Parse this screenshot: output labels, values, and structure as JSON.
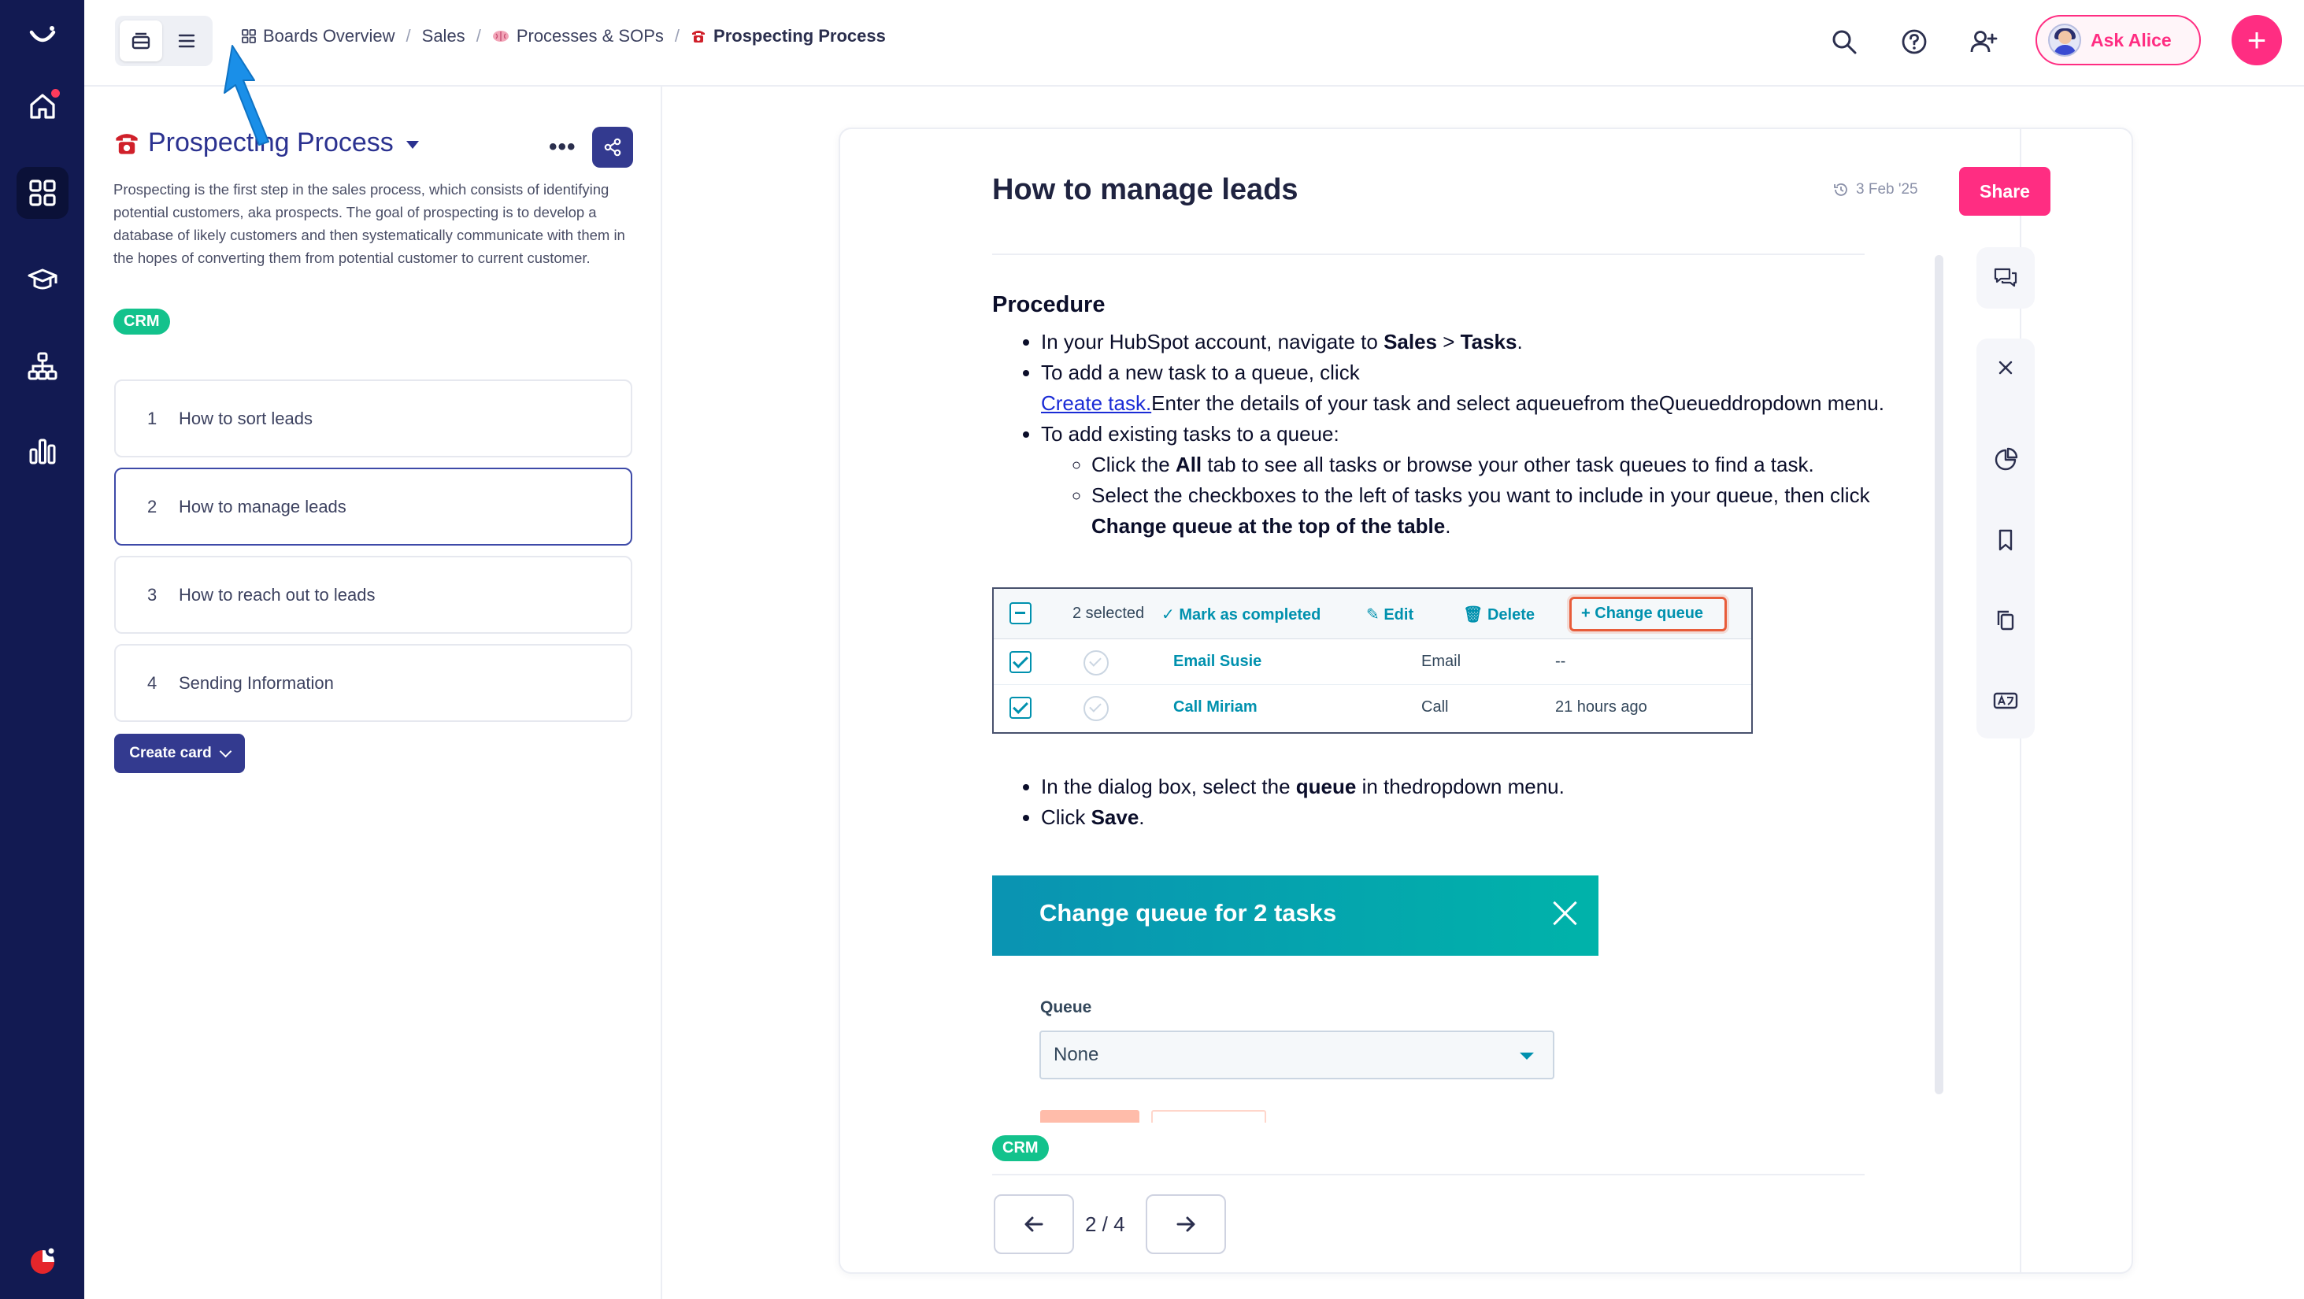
{
  "colors": {
    "rail": "#121a52",
    "brand_pink": "#ff2d82",
    "indigo": "#333a8f",
    "tag_green": "#13c28c",
    "pointer_blue": "#1a8fe8"
  },
  "rail": {
    "items": [
      {
        "icon": "home-icon",
        "active": false
      },
      {
        "icon": "boards-grid-icon",
        "active": true
      },
      {
        "icon": "graduation-cap-icon",
        "active": false
      },
      {
        "icon": "org-chart-icon",
        "active": false
      },
      {
        "icon": "bar-chart-icon",
        "active": false
      }
    ]
  },
  "topbar": {
    "breadcrumbs": [
      {
        "icon": "grid-icon",
        "label": "Boards Overview"
      },
      {
        "icon": "",
        "label": "Sales"
      },
      {
        "icon": "brain-emoji",
        "label": "Processes & SOPs"
      },
      {
        "icon": "telephone-emoji",
        "label": "Prospecting Process"
      }
    ],
    "ask_label": "Ask Alice"
  },
  "board": {
    "title": "Prospecting Process",
    "description": "Prospecting is the first step in the sales process, which consists of identifying potential customers, aka prospects. The goal of prospecting is to develop a database of likely customers and then systematically communicate with them in the hopes of converting them from potential customer to current customer.",
    "tag": "CRM",
    "cards": [
      {
        "num": "1",
        "label": "How to sort leads",
        "active": false
      },
      {
        "num": "2",
        "label": "How to manage leads",
        "active": true
      },
      {
        "num": "3",
        "label": "How to reach out to leads",
        "active": false
      },
      {
        "num": "4",
        "label": "Sending Information",
        "active": false
      }
    ],
    "create_card_label": "Create card"
  },
  "doc": {
    "title": "How to manage leads",
    "date": "3 Feb '25",
    "procedure_heading": "Procedure",
    "step1_pre": "In your HubSpot account, navigate to ",
    "step1_sales": "Sales",
    "step1_gt": " > ",
    "step1_tasks": "Tasks",
    "step1_end": ".",
    "step2_pre": "To add a new task to a queue, click",
    "step2_link": "Create task.",
    "step2_post": "Enter the details of your task and select aqueuefrom theQueueddropdown menu.",
    "step3": "To add existing tasks to a queue:",
    "sub1_pre": "Click the ",
    "sub1_bold": "All",
    "sub1_post": " tab to see all tasks or browse your other task queues to find a task.",
    "sub2_pre": "Select the checkboxes to the left of tasks you want to include in your queue, then click",
    "sub2_bold": "Change queue at the top of the table",
    "sub2_end": ".",
    "step4_pre": "In the dialog box, select the ",
    "step4_bold": "queue",
    "step4_post": " in thedropdown menu.",
    "step5_pre": "Click ",
    "step5_bold": "Save",
    "step5_end": ".",
    "shot": {
      "selected": "2 selected",
      "mark_completed": "Mark as completed",
      "edit": "Edit",
      "delete": "Delete",
      "change_queue": "Change queue",
      "rows": [
        {
          "name": "Email Susie",
          "type": "Email",
          "when": "--"
        },
        {
          "name": "Call Miriam",
          "type": "Call",
          "when": "21 hours ago"
        }
      ]
    },
    "dialog": {
      "title": "Change queue for 2 tasks",
      "queue_label": "Queue",
      "queue_value": "None"
    },
    "tag": "CRM",
    "pager": "2 / 4",
    "share_label": "Share"
  }
}
